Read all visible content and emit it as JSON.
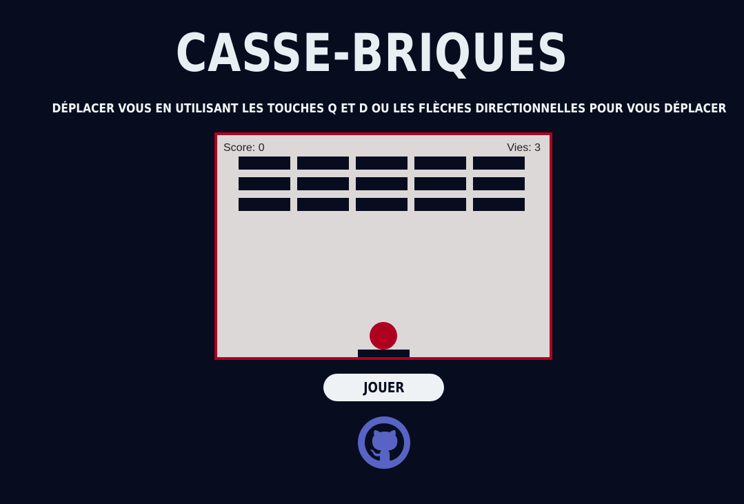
{
  "header": {
    "title": "CASSE-BRIQUES",
    "instructions": "DÉPLACER VOUS EN UTILISANT LES TOUCHES Q ET D OU LES FLÈCHES DIRECTIONNELLES POUR VOUS DÉPLACER"
  },
  "game": {
    "score_label": "Score: 0",
    "lives_label": "Vies: 3",
    "brick_rows": 3,
    "brick_columns": 5
  },
  "controls": {
    "play_label": "JOUER"
  },
  "footer": {
    "github_icon": "github-icon"
  },
  "colors": {
    "background": "#070d1f",
    "board": "#dcd8d8",
    "accent": "#b0001f",
    "brick": "#070d1f",
    "github": "#5864c4"
  }
}
